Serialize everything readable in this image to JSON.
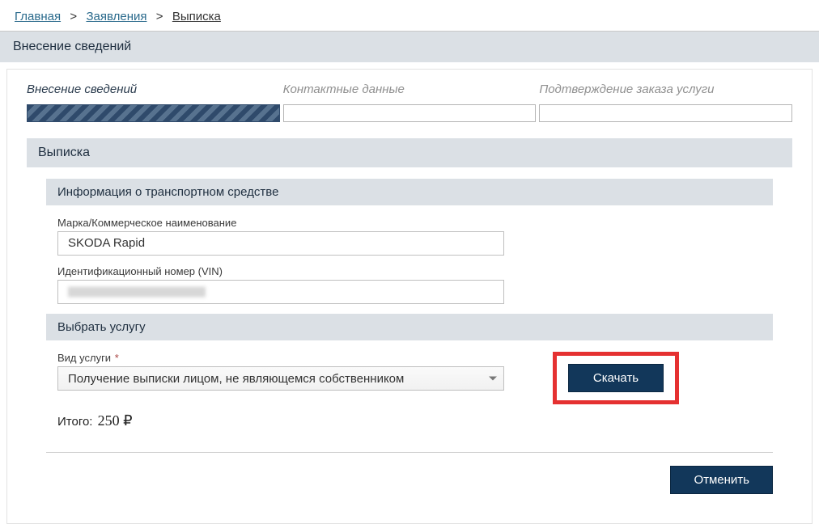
{
  "breadcrumb": {
    "home": "Главная",
    "applications": "Заявления",
    "current": "Выписка"
  },
  "panel_title": "Внесение сведений",
  "steps": {
    "s1": "Внесение сведений",
    "s2": "Контактные данные",
    "s3": "Подтверждение заказа услуги"
  },
  "section_title": "Выписка",
  "vehicle_info": {
    "header": "Информация о транспортном средстве",
    "brand_label": "Марка/Коммерческое наименование",
    "brand_value": "SKODA Rapid",
    "vin_label": "Идентификационный номер (VIN)",
    "vin_value": ""
  },
  "service": {
    "header": "Выбрать услугу",
    "type_label": "Вид услуги",
    "required_mark": "*",
    "type_value": "Получение выписки лицом, не являющемся собственником",
    "download_label": "Скачать"
  },
  "total": {
    "label": "Итого:",
    "amount": "250 ₽"
  },
  "footer": {
    "cancel_label": "Отменить"
  }
}
